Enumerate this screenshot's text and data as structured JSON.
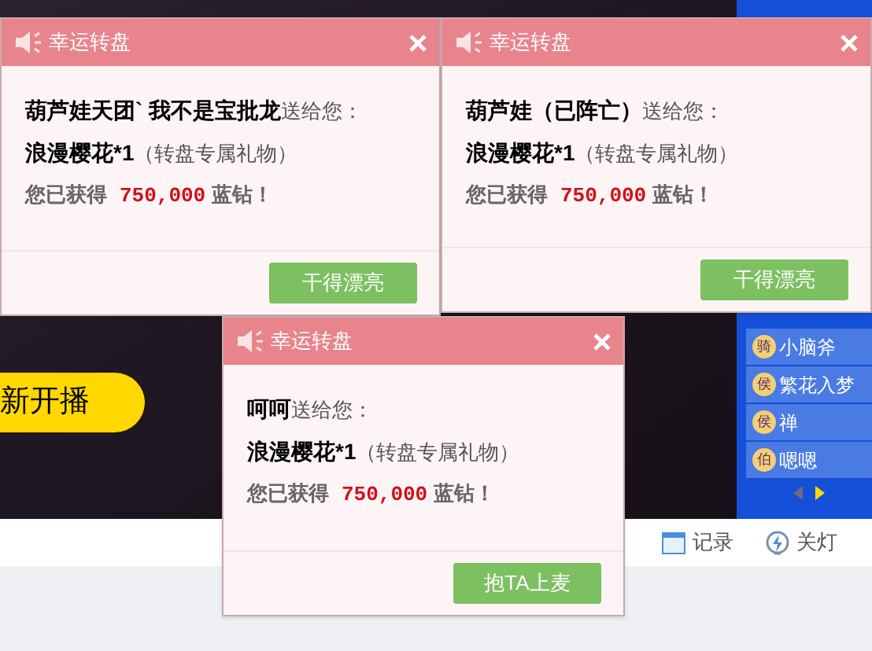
{
  "stage": {
    "start_button": "新开播"
  },
  "sidebar": {
    "items": [
      {
        "badge": "骑",
        "name": "小脑斧"
      },
      {
        "badge": "侯",
        "name": "繁花入梦"
      },
      {
        "badge": "侯",
        "name": "禅"
      },
      {
        "badge": "伯",
        "name": "嗯嗯"
      }
    ]
  },
  "toolbar": [
    {
      "kind": "calendar",
      "label": "记录"
    },
    {
      "kind": "bulb",
      "label": "关灯"
    }
  ],
  "popups": [
    {
      "title": "幸运转盘",
      "sender": "葫芦娃天团` 我不是宝批龙",
      "verb": "送给您：",
      "gift": "浪漫樱花*1",
      "note": "（转盘专属礼物）",
      "earned_label": "您已获得",
      "amount": "750,000",
      "unit": "蓝钻！",
      "button": "干得漂亮"
    },
    {
      "title": "幸运转盘",
      "sender": "葫芦娃（已阵亡）",
      "verb": "送给您：",
      "gift": "浪漫樱花*1",
      "note": "（转盘专属礼物）",
      "earned_label": "您已获得",
      "amount": "750,000",
      "unit": "蓝钻！",
      "button": "干得漂亮"
    },
    {
      "title": "幸运转盘",
      "sender": "呵呵",
      "verb": "送给您：",
      "gift": "浪漫樱花*1",
      "note": "（转盘专属礼物）",
      "earned_label": "您已获得",
      "amount": "750,000",
      "unit": "蓝钻！",
      "button": "抱TA上麦"
    }
  ]
}
